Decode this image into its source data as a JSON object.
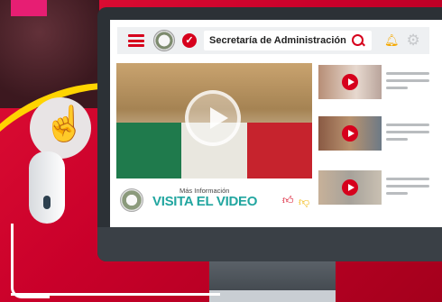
{
  "toolbar": {
    "search_text": "Secretaría de Administración",
    "icons": [
      "menu-icon",
      "seal-icon",
      "check-icon",
      "search-icon",
      "bell-icon",
      "gear-icon"
    ]
  },
  "video": {
    "more_info": "Más Información",
    "cta": "VISITA EL VIDEO",
    "icons": [
      "play-icon",
      "thumbs-up-icon",
      "thumbs-down-icon"
    ]
  },
  "side_list": {
    "items": [
      {
        "name": "video-thumb-1"
      },
      {
        "name": "video-thumb-2"
      },
      {
        "name": "video-thumb-3"
      }
    ]
  },
  "colors": {
    "accent": "#d6001c",
    "cta": "#22a6a0",
    "background": "#c9002a"
  }
}
